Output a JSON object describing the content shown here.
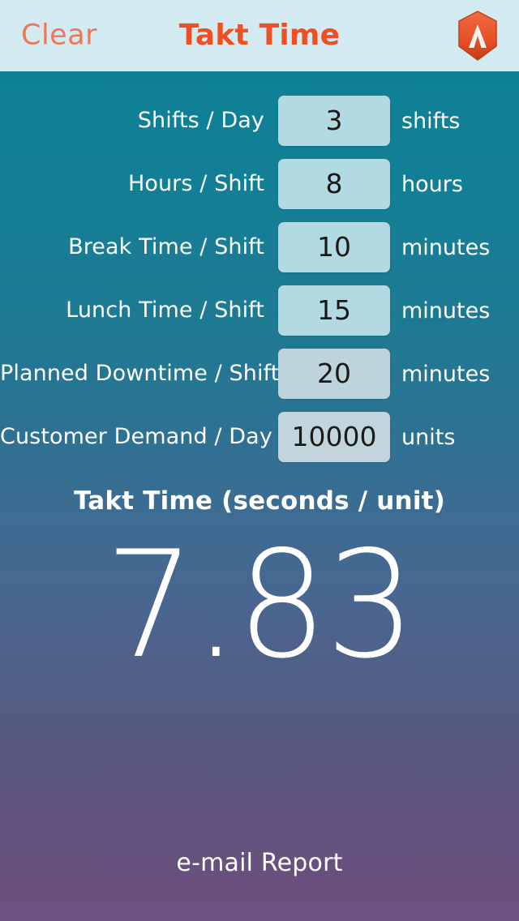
{
  "header": {
    "clear_label": "Clear",
    "title": "Takt Time",
    "logo_icon": "hexagon-lambda-logo-icon",
    "background_color": "#d2eaf0",
    "title_color": "#f04e23",
    "clear_color": "#e8795a",
    "logo_color": "#e8522a"
  },
  "form": {
    "rows": [
      {
        "label": "Shifts / Day",
        "value": "3",
        "unit": "shifts"
      },
      {
        "label": "Hours / Shift",
        "value": "8",
        "unit": "hours"
      },
      {
        "label": "Break Time / Shift",
        "value": "10",
        "unit": "minutes"
      },
      {
        "label": "Lunch Time / Shift",
        "value": "15",
        "unit": "minutes"
      },
      {
        "label": "Planned Downtime / Shift",
        "value": "20",
        "unit": "minutes"
      },
      {
        "label": "Customer Demand / Day",
        "value": "10000",
        "unit": "units"
      }
    ]
  },
  "result": {
    "caption": "Takt Time (seconds / unit)",
    "value": "7.83"
  },
  "footer": {
    "email_report_label": "e-mail Report"
  },
  "theme": {
    "gradient_top": "#0e8096",
    "gradient_mid": "#3d6c92",
    "gradient_bottom": "#6b4f7d",
    "input_background": "#b3d9e2",
    "text_color": "#ffffff"
  }
}
